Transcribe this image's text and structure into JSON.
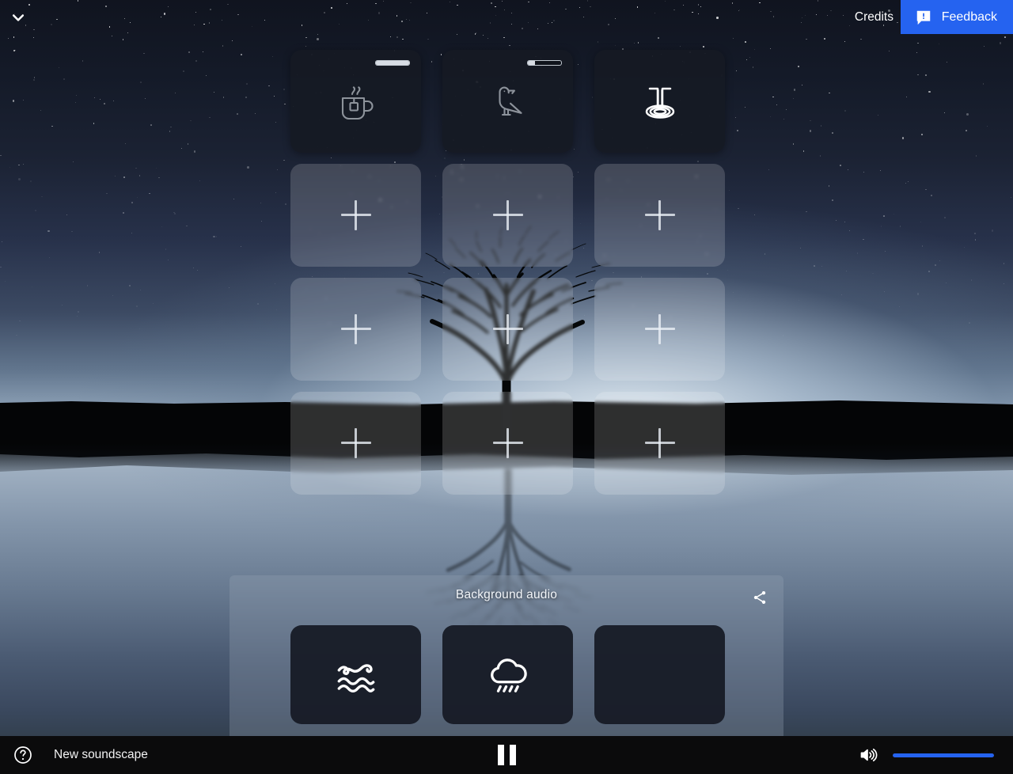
{
  "topbar": {
    "collapse_icon": "chevron-down-icon",
    "credits_label": "Credits",
    "feedback_label": "Feedback",
    "feedback_icon": "feedback-speech-bubble-icon",
    "feedback_color": "#2563f0"
  },
  "grid": {
    "columns": 3,
    "rows": 4,
    "tiles": [
      {
        "icon": "tea-cup-icon",
        "state": "active",
        "has_volume": true,
        "volume": 100,
        "label": "Hot tea"
      },
      {
        "icon": "bird-icon",
        "state": "active",
        "has_volume": true,
        "volume": 22,
        "label": "Bird"
      },
      {
        "icon": "waterfall-icon",
        "state": "active",
        "has_volume": false,
        "volume": 100,
        "label": "Waterfall"
      },
      {
        "icon": "plus-icon",
        "state": "empty",
        "label": "Add sound"
      },
      {
        "icon": "plus-icon",
        "state": "empty",
        "label": "Add sound"
      },
      {
        "icon": "plus-icon",
        "state": "empty",
        "label": "Add sound"
      },
      {
        "icon": "plus-icon",
        "state": "empty",
        "label": "Add sound"
      },
      {
        "icon": "plus-icon",
        "state": "empty",
        "label": "Add sound"
      },
      {
        "icon": "plus-icon",
        "state": "empty",
        "label": "Add sound"
      },
      {
        "icon": "plus-icon",
        "state": "empty",
        "label": "Add sound"
      },
      {
        "icon": "plus-icon",
        "state": "empty",
        "label": "Add sound"
      },
      {
        "icon": "plus-icon",
        "state": "empty",
        "label": "Add sound"
      }
    ]
  },
  "background_audio": {
    "title": "Background audio",
    "share_icon": "share-icon",
    "tiles": [
      {
        "icon": "waves-icon",
        "state": "active",
        "label": "Waves"
      },
      {
        "icon": "rain-cloud-icon",
        "state": "active",
        "label": "Rain"
      },
      {
        "icon": "",
        "state": "empty",
        "label": ""
      }
    ]
  },
  "bottombar": {
    "help_icon": "help-question-icon",
    "soundscape_name": "New soundscape",
    "transport_icon": "pause-icon",
    "volume_icon": "speaker-high-icon",
    "volume_value": 100,
    "volume_color": "#2563f0"
  }
}
